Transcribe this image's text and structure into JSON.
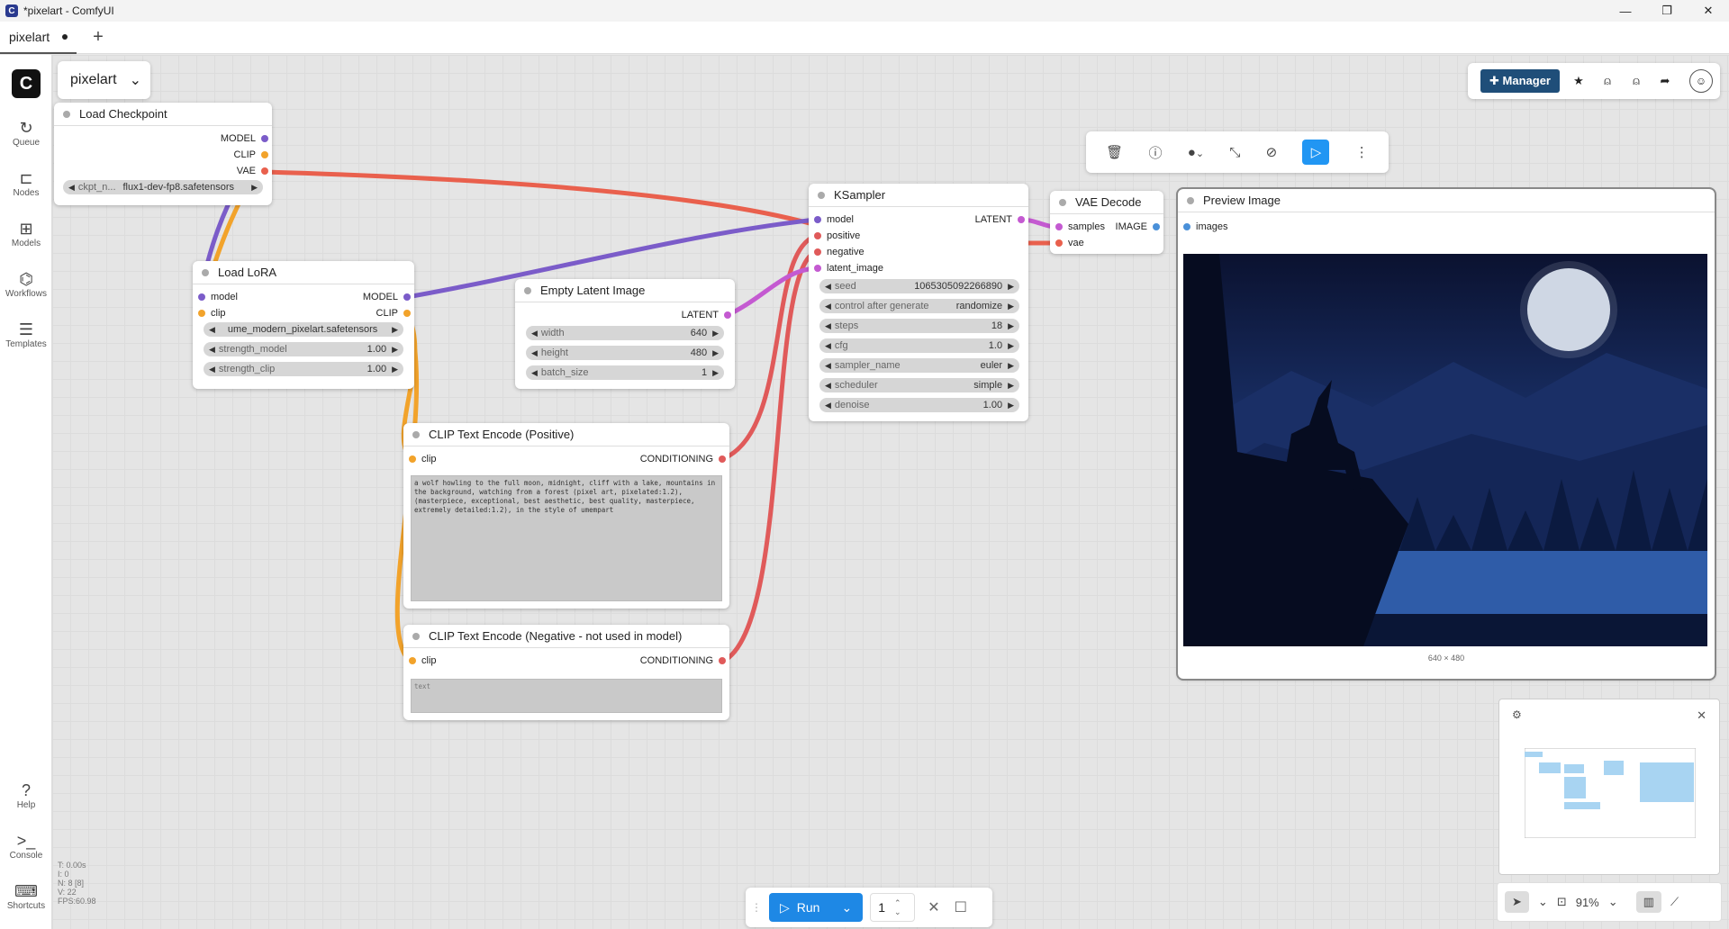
{
  "window": {
    "title": "*pixelart - ComfyUI",
    "logo": "C",
    "minimize": "—",
    "maximize": "❐",
    "close": "✕"
  },
  "tab": {
    "label": "pixelart",
    "add": "+"
  },
  "sidebar": {
    "logo": "C",
    "items": [
      {
        "label": "Queue",
        "icon": "↻"
      },
      {
        "label": "Nodes",
        "icon": "⊏"
      },
      {
        "label": "Models",
        "icon": "⊞"
      },
      {
        "label": "Workflows",
        "icon": "⌬"
      },
      {
        "label": "Templates",
        "icon": "☰"
      },
      {
        "label": "Help",
        "icon": "?"
      },
      {
        "label": "Console",
        "icon": ">_"
      },
      {
        "label": "Shortcuts",
        "icon": "⌨"
      }
    ]
  },
  "workflow_selector": {
    "label": "pixelart",
    "chevron": "⌄"
  },
  "topbar": {
    "manager": "Manager",
    "manager_icon": "✚",
    "icons": [
      "★",
      "⍝",
      "⍝",
      "➦"
    ],
    "avatar": "☺"
  },
  "selection_toolbar": {
    "icons": [
      "🗑",
      "ⓘ",
      "●",
      "⤡",
      "⊘",
      "▷",
      "⋮"
    ],
    "chevron": "⌄"
  },
  "nodes": {
    "load_checkpoint": {
      "title": "Load Checkpoint",
      "outputs": [
        "MODEL",
        "CLIP",
        "VAE"
      ],
      "ckpt_label": "ckpt_n...",
      "ckpt_value": "flux1-dev-fp8.safetensors"
    },
    "load_lora": {
      "title": "Load LoRA",
      "inputs": [
        "model",
        "clip"
      ],
      "outputs": [
        "MODEL",
        "CLIP"
      ],
      "lora_name": "ume_modern_pixelart.safetensors",
      "strength_model_label": "strength_model",
      "strength_model": "1.00",
      "strength_clip_label": "strength_clip",
      "strength_clip": "1.00"
    },
    "empty_latent": {
      "title": "Empty Latent Image",
      "output": "LATENT",
      "width_label": "width",
      "width": "640",
      "height_label": "height",
      "height": "480",
      "batch_label": "batch_size",
      "batch": "1"
    },
    "ksampler": {
      "title": "KSampler",
      "inputs": [
        "model",
        "positive",
        "negative",
        "latent_image"
      ],
      "output": "LATENT",
      "widgets": [
        {
          "label": "seed",
          "value": "1065305092266890"
        },
        {
          "label": "control after generate",
          "value": "randomize"
        },
        {
          "label": "steps",
          "value": "18"
        },
        {
          "label": "cfg",
          "value": "1.0"
        },
        {
          "label": "sampler_name",
          "value": "euler"
        },
        {
          "label": "scheduler",
          "value": "simple"
        },
        {
          "label": "denoise",
          "value": "1.00"
        }
      ]
    },
    "vae_decode": {
      "title": "VAE Decode",
      "inputs": [
        "samples",
        "vae"
      ],
      "output": "IMAGE"
    },
    "preview": {
      "title": "Preview Image",
      "input": "images",
      "size": "640 × 480"
    },
    "clip_pos": {
      "title": "CLIP Text Encode (Positive)",
      "input": "clip",
      "output": "CONDITIONING",
      "text": "a wolf howling to the full moon, midnight, cliff with a lake, mountains in the background, watching from a forest (pixel art, pixelated:1.2), (masterpiece, exceptional, best aesthetic, best quality, masterpiece, extremely detailed:1.2), in the style of umempart"
    },
    "clip_neg": {
      "title": "CLIP Text Encode (Negative - not used in model)",
      "input": "clip",
      "output": "CONDITIONING",
      "placeholder": "text"
    }
  },
  "stats": [
    "T: 0.00s",
    "I: 0",
    "N: 8 [8]",
    "V: 22",
    "FPS:60.98"
  ],
  "runbar": {
    "run": "Run",
    "count": "1",
    "run_icon": "▷",
    "chevron": "⌄",
    "up": "⌃",
    "down": "⌄",
    "cancel": "✕",
    "stop": "☐"
  },
  "minimap": {
    "settings_icon": "⚙",
    "close": "✕"
  },
  "canvas_controls": {
    "select_icon": "➤",
    "chevron": "⌄",
    "fit_icon": "⊡",
    "zoom": "91%",
    "map_icon": "▥",
    "link_icon": "⟋"
  },
  "colors": {
    "model_link": "#7b5cc9",
    "clip_link": "#f2a32b",
    "vae_link": "#e9604d",
    "conditioning_link": "#e05a5a",
    "latent_link": "#c45ad1",
    "accent": "#1e88e5"
  }
}
